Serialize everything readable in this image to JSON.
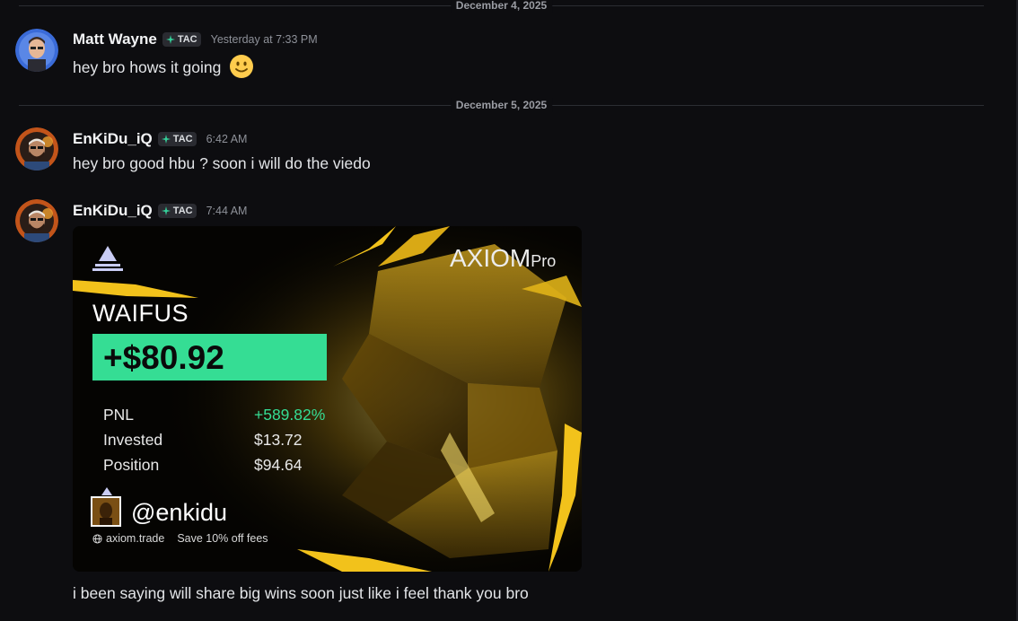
{
  "dividers": [
    "December 4, 2025",
    "December 5, 2025"
  ],
  "messages": [
    {
      "user": "Matt Wayne",
      "tag": "TAC",
      "time": "Yesterday at 7:33 PM",
      "text": "hey bro hows it going",
      "emoji": "slightly-smiling-face"
    },
    {
      "user": "EnKiDu_iQ",
      "tag": "TAC",
      "time": "6:42 AM",
      "text": "hey bro good hbu ? soon i will do the viedo"
    },
    {
      "user": "EnKiDu_iQ",
      "tag": "TAC",
      "time": "7:44 AM",
      "text": "i been saying will share big wins soon just like i feel thank you bro"
    }
  ],
  "card": {
    "brand": "AXIOM",
    "brand_suffix": "Pro",
    "token": "WAIFUS",
    "amount": "+$80.92",
    "rows": [
      {
        "label": "PNL",
        "value": "+589.82%"
      },
      {
        "label": "Invested",
        "value": "$13.72"
      },
      {
        "label": "Position",
        "value": "$94.64"
      }
    ],
    "handle": "@enkidu",
    "site": "axiom.trade",
    "promo": "Save 10% off fees",
    "colors": {
      "gain": "#35dd94",
      "gold": "#f2c21b"
    }
  },
  "colors": {
    "background": "#0d0d10",
    "username": "#f2f3f5",
    "timestamp": "#8e9199"
  }
}
